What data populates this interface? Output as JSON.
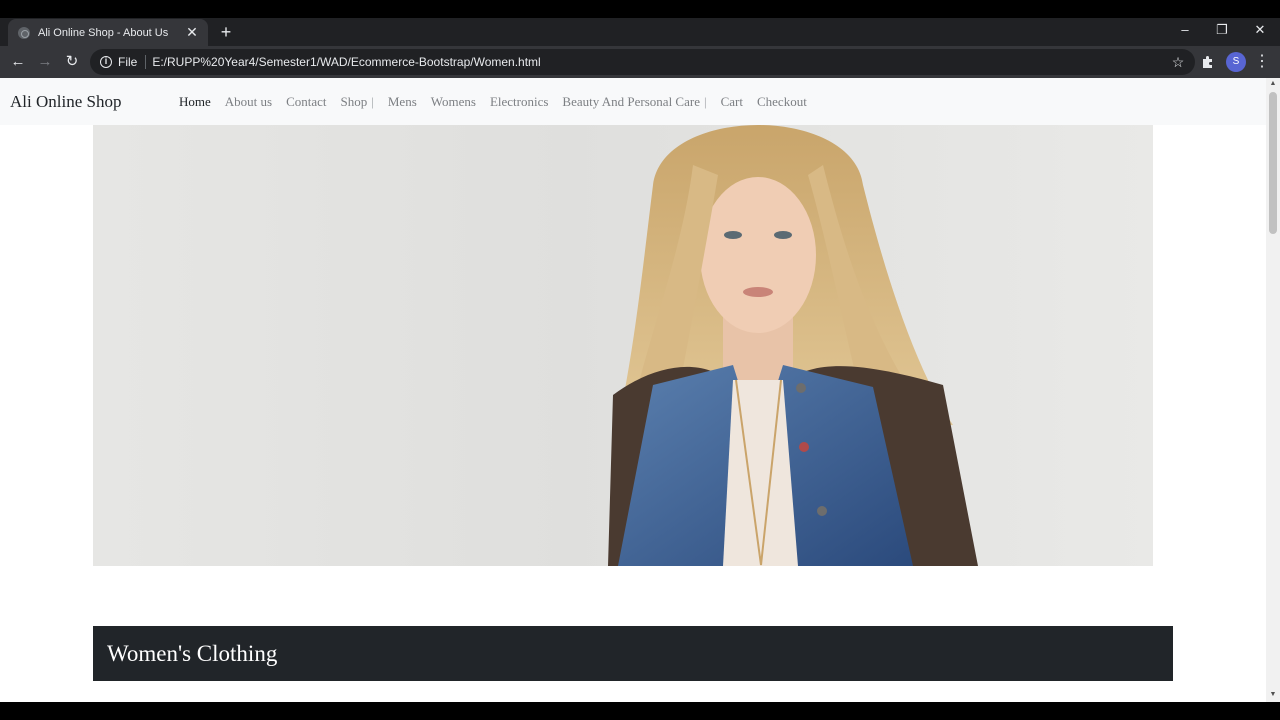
{
  "browser": {
    "tab_title": "Ali Online Shop - About Us",
    "url_scheme": "File",
    "url": "E:/RUPP%20Year4/Semester1/WAD/Ecommerce-Bootstrap/Women.html",
    "profile_initial": "S",
    "icons": [
      "globe-icon",
      "close-icon",
      "plus-icon",
      "minimize-icon",
      "restore-icon",
      "back-icon",
      "forward-icon",
      "reload-icon",
      "info-icon",
      "star-icon",
      "puzzle-icon",
      "kebab-menu-icon"
    ]
  },
  "site": {
    "brand": "Ali Online Shop",
    "nav": [
      {
        "label": "Home",
        "active": true
      },
      {
        "label": "About us"
      },
      {
        "label": "Contact"
      },
      {
        "label": "Shop"
      },
      {
        "label": "Mens"
      },
      {
        "label": "Womens"
      },
      {
        "label": "Electronics"
      },
      {
        "label": "Beauty And Personal Care"
      },
      {
        "label": "Cart"
      },
      {
        "label": "Checkout"
      }
    ],
    "divider": "|",
    "section_title": "Women's Clothing"
  },
  "colors": {
    "chrome_dark": "#202124",
    "chrome_mid": "#35363a",
    "nav_bg": "#f8f9fa",
    "banner_bg": "#212529"
  }
}
